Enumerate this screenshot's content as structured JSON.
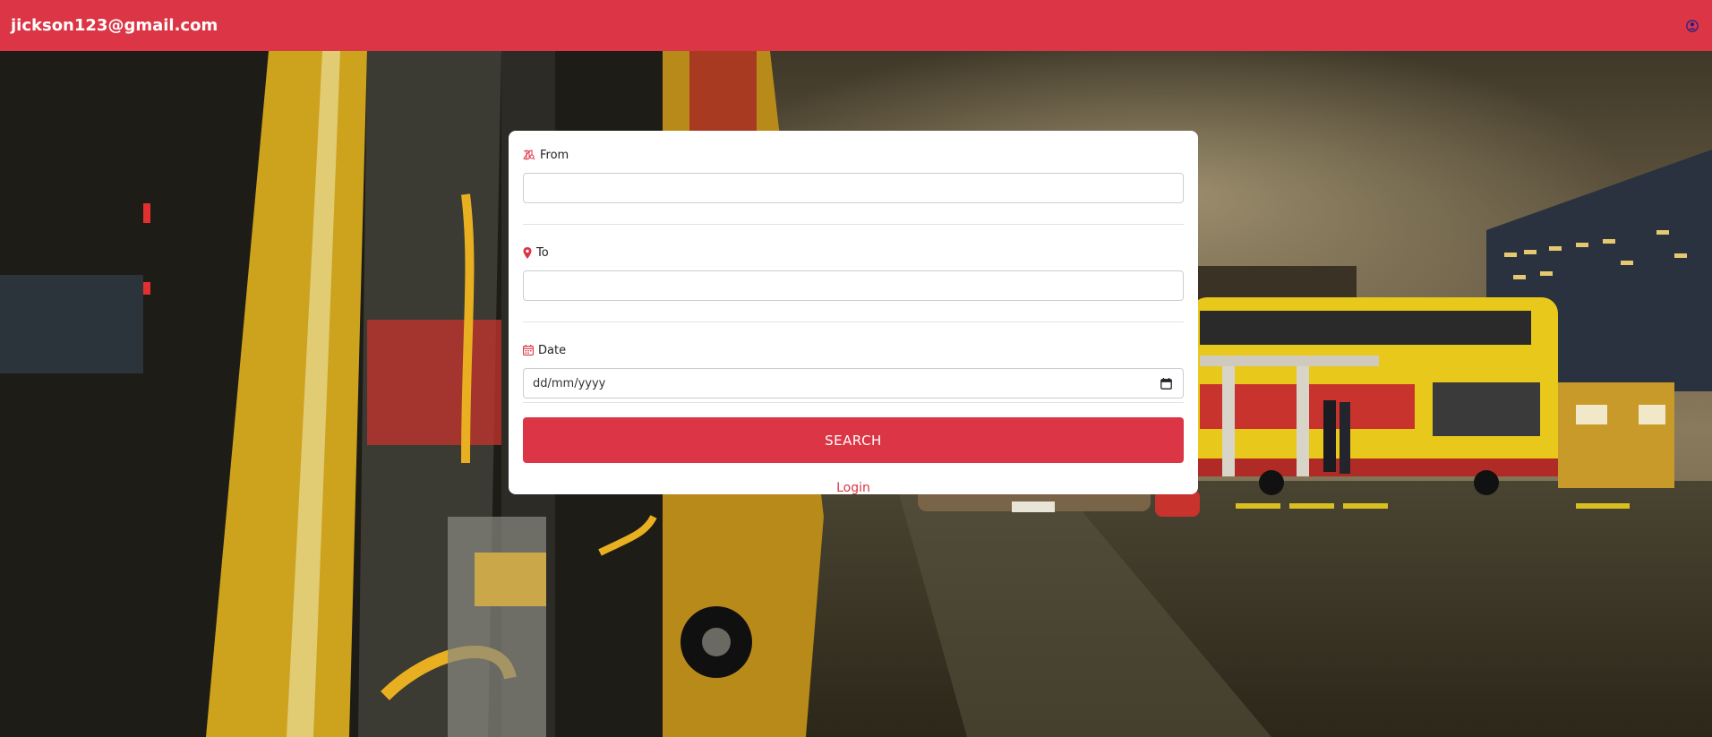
{
  "header": {
    "user_email": "jickson123@gmail.com",
    "user_icon": "user-circle-icon"
  },
  "form": {
    "from": {
      "label": "From",
      "icon": "map-search-icon",
      "value": ""
    },
    "to": {
      "label": "To",
      "icon": "map-pin-icon",
      "value": ""
    },
    "date": {
      "label": "Date",
      "icon": "calendar-icon",
      "placeholder": "dd/mm/yyyy"
    },
    "search_label": "SEARCH",
    "login_label": "Login"
  },
  "colors": {
    "accent": "#dc3545",
    "header_text": "#ffffff",
    "user_icon": "#1a1f8c"
  }
}
